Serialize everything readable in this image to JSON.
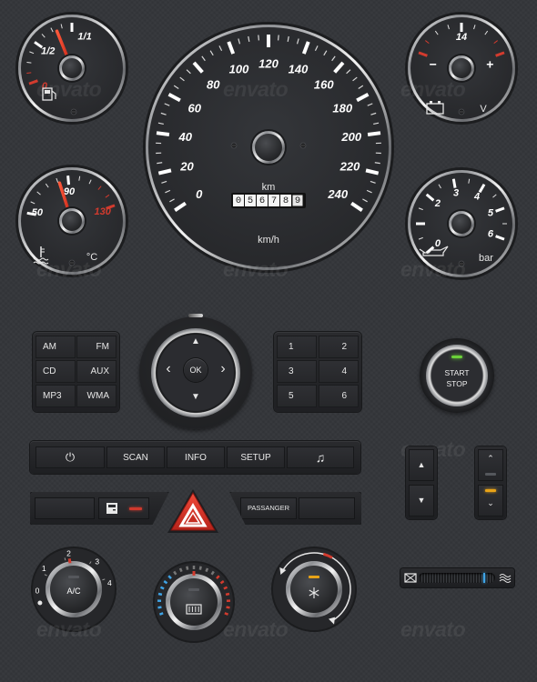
{
  "fuel_gauge": {
    "labels": [
      "0",
      "1/2",
      "1/1"
    ],
    "level": 0.8
  },
  "battery_gauge": {
    "labels": [
      "−",
      "14",
      "+"
    ],
    "unit": "V",
    "value": 14
  },
  "speedometer": {
    "labels": [
      "0",
      "20",
      "40",
      "60",
      "80",
      "100",
      "120",
      "140",
      "160",
      "180",
      "200",
      "220",
      "240"
    ],
    "unit_top": "km",
    "unit_bottom": "km/h",
    "odometer_digits": [
      "0",
      "5",
      "6",
      "7",
      "8",
      "9"
    ],
    "value": 120
  },
  "temp_gauge": {
    "labels": [
      "50",
      "90",
      "130"
    ],
    "unit": "°C",
    "value": 75
  },
  "oil_gauge": {
    "labels": [
      "0",
      "2",
      "3",
      "4",
      "5",
      "6"
    ],
    "unit": "bar",
    "value": 1.0
  },
  "radio": {
    "buttons": [
      "AM",
      "FM",
      "CD",
      "AUX",
      "MP3",
      "WMA"
    ]
  },
  "nav": {
    "ok": "OK",
    "up": "▲",
    "down": "▼",
    "left": "‹",
    "right": "›"
  },
  "presets": {
    "buttons": [
      "1",
      "2",
      "3",
      "4",
      "5",
      "6"
    ]
  },
  "start": {
    "line1": "START",
    "line2": "STOP"
  },
  "media": {
    "power_icon": "⏻",
    "scan": "SCAN",
    "info": "INFO",
    "setup": "SETUP",
    "music_icon": "♫"
  },
  "passenger": {
    "label": "PASSANGER"
  },
  "climate": {
    "ac_labels": [
      "0",
      "1",
      "2",
      "3",
      "4"
    ],
    "ac_label": "A/C",
    "fan_setting": 2
  },
  "watermark": "envato",
  "colors": {
    "accent_red": "#d23b2e",
    "led_green": "#6bd23a",
    "led_amber": "#e8a317",
    "led_blue": "#3fa4e6"
  }
}
